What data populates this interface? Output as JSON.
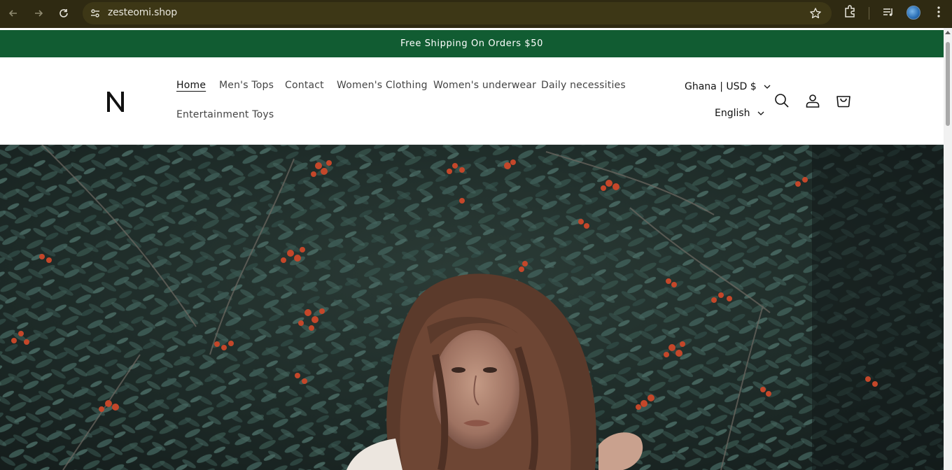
{
  "browser": {
    "url": "zesteomi.shop"
  },
  "announcement": {
    "text": "Free Shipping On Orders $50"
  },
  "header": {
    "logo_letter": "N",
    "menu": [
      {
        "label": "Home",
        "active": true
      },
      {
        "label": "Men's Tops"
      },
      {
        "label": "Contact"
      },
      {
        "label": "Women's Clothing"
      },
      {
        "label": "Women's underwear"
      },
      {
        "label": "Daily necessities"
      },
      {
        "label": "Entertainment Toys"
      }
    ],
    "country_selector": "Ghana | USD $",
    "language_selector": "English"
  },
  "icons": {
    "back": "arrow-left-icon",
    "forward": "arrow-right-icon",
    "reload": "reload-icon",
    "site_info": "tune-icon",
    "bookmark": "star-icon",
    "extensions": "puzzle-icon",
    "media": "media-control-icon",
    "profile": "avatar",
    "menu": "kebab-menu-icon",
    "search": "search-icon",
    "account": "user-icon",
    "cart": "cart-icon"
  },
  "colors": {
    "announcement_bg": "#115c32",
    "chrome_bg": "#2f2a12"
  }
}
